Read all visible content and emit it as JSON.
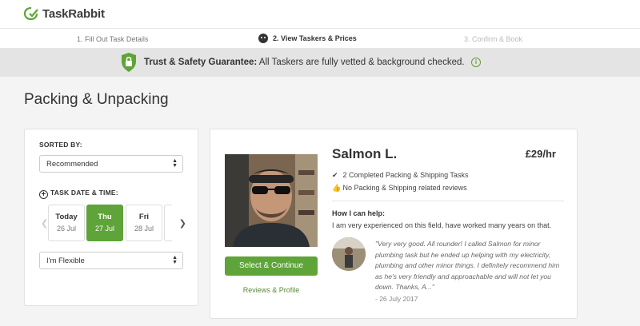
{
  "brand": {
    "name": "TaskRabbit",
    "accent": "#5ea438"
  },
  "steps": [
    {
      "label": "1. Fill Out Task Details"
    },
    {
      "label": "2. View Taskers & Prices"
    },
    {
      "label": "3. Confirm & Book"
    }
  ],
  "trust": {
    "title": "Trust & Safety Guarantee:",
    "text": " All Taskers are fully vetted & background checked."
  },
  "page": {
    "title": "Packing & Unpacking"
  },
  "filters": {
    "sorted_by_label": "SORTED BY:",
    "sort_value": "Recommended",
    "date_label": "TASK DATE & TIME:",
    "dates": [
      {
        "day": "Today",
        "date": "26 Jul",
        "selected": false
      },
      {
        "day": "Thu",
        "date": "27 Jul",
        "selected": true
      },
      {
        "day": "Fri",
        "date": "28 Jul",
        "selected": false
      }
    ],
    "time_value": "I'm Flexible"
  },
  "tasker": {
    "name": "Salmon L.",
    "price": "£29/hr",
    "completed": "2 Completed Packing & Shipping Tasks",
    "reviews_note": "No Packing & Shipping related reviews",
    "help_title": "How I can help:",
    "help_text": "I am very experienced on this field, have worked many years on that.",
    "review": "\"Very very good. All rounder! I called Salmon for minor plumbing task but he ended up helping with my electricity, plumbing and other minor things. I definitely recommend him as he's very friendly and approachable and will not let you down. Thanks, A...\"",
    "review_date": "- 26 July 2017",
    "select_label": "Select & Continue",
    "profile_link": "Reviews & Profile"
  }
}
